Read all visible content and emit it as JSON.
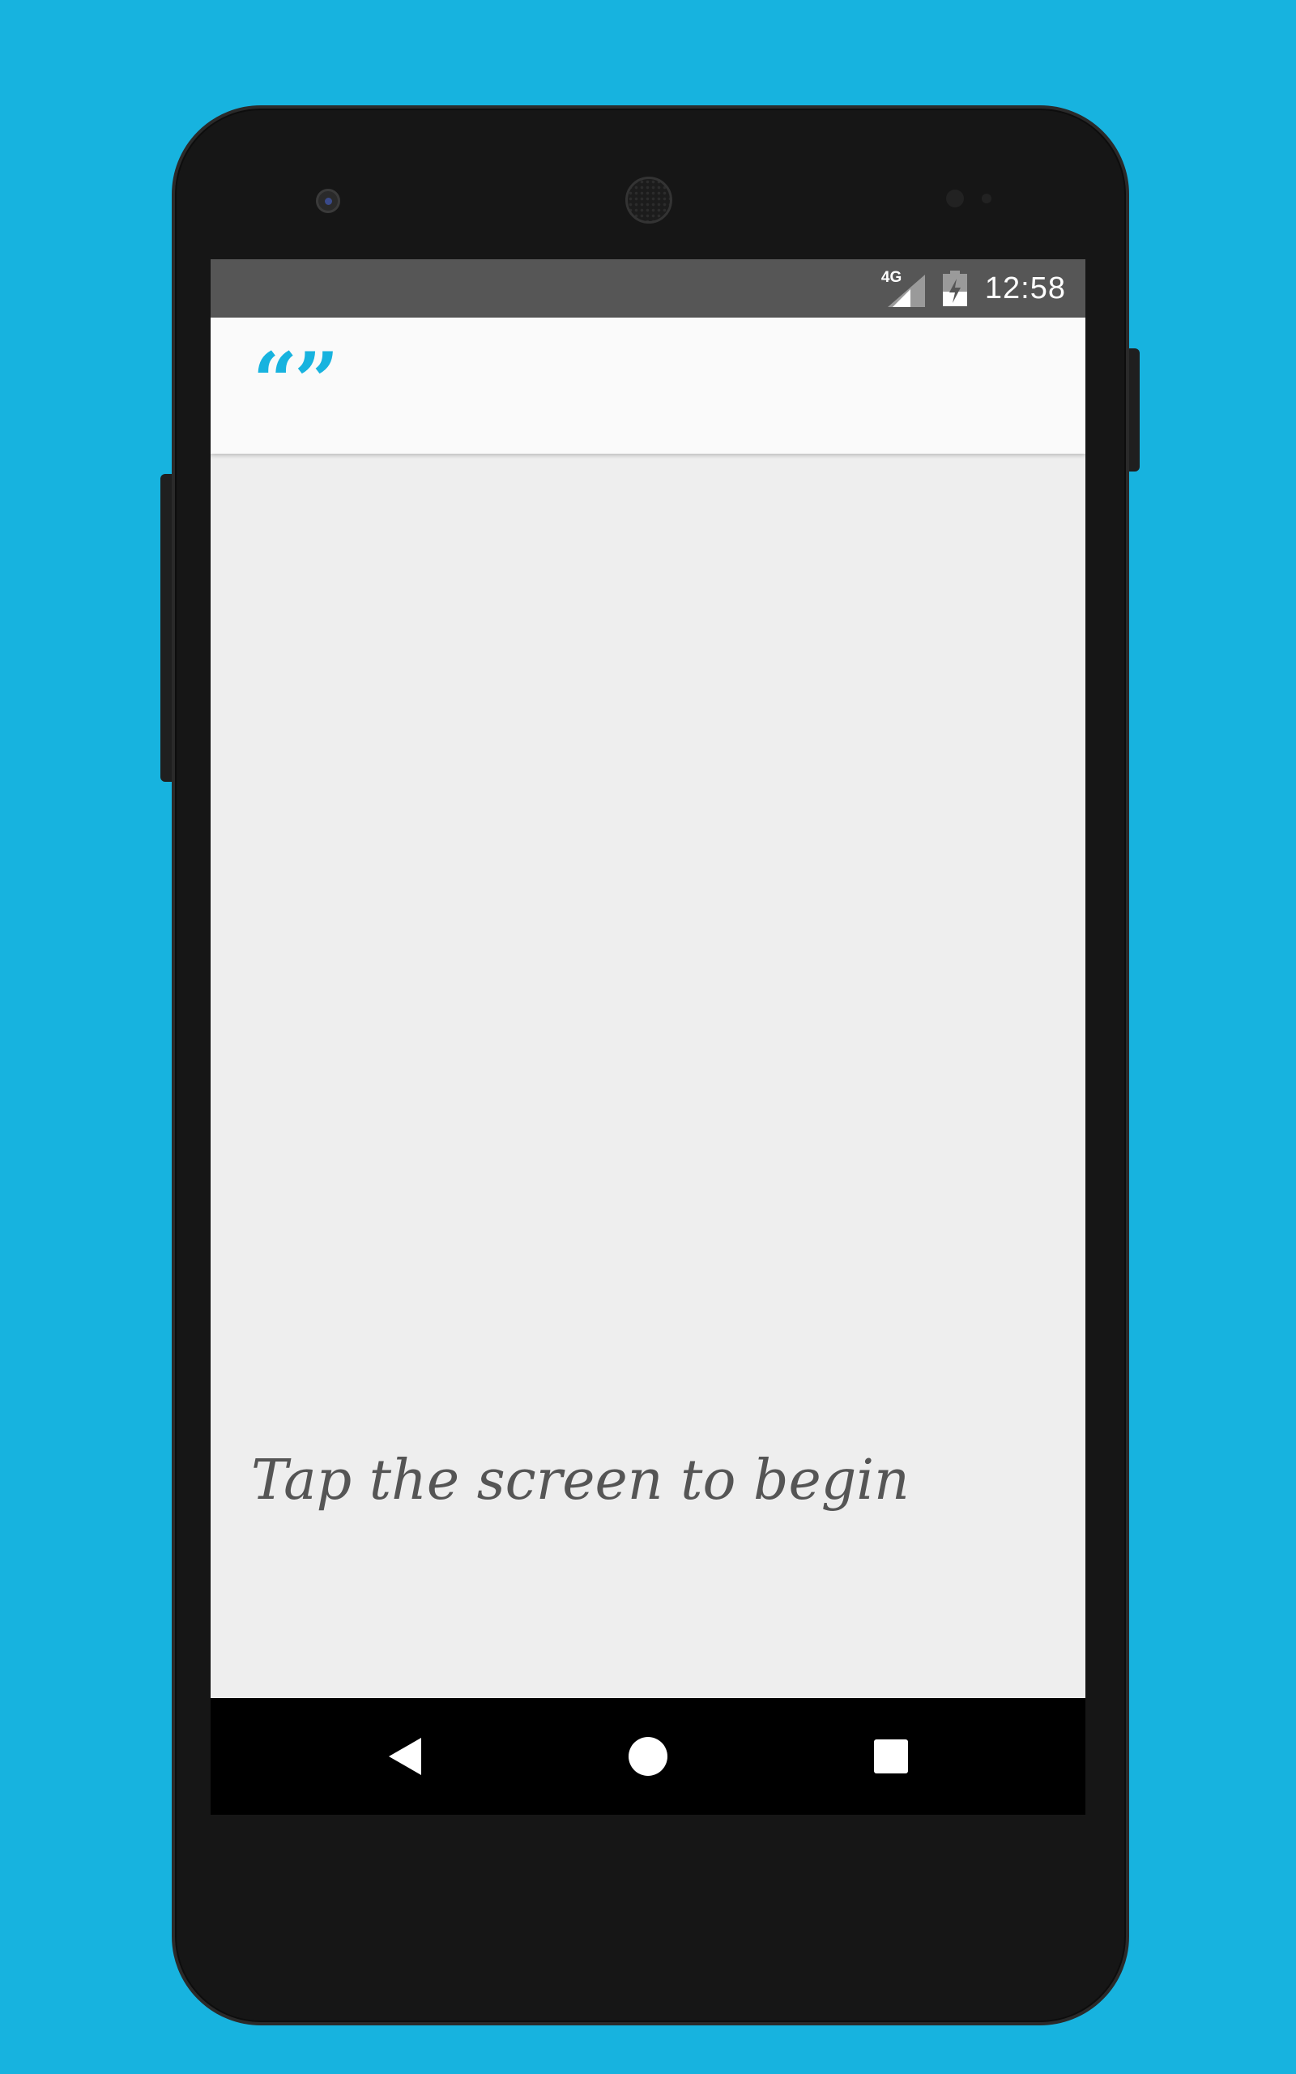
{
  "colors": {
    "background": "#17b3df",
    "accent": "#17b3df",
    "status_bar": "#565656",
    "app_bar": "#fafafa",
    "content_bg": "#eeeeee",
    "prompt_text": "#555555",
    "nav_bar": "#000000"
  },
  "status_bar": {
    "network_type": "4G",
    "time": "12:58",
    "icons": [
      "signal-icon",
      "battery-charging-icon"
    ]
  },
  "app_bar": {
    "logo": "“”"
  },
  "main": {
    "prompt": "Tap the screen to begin"
  },
  "nav_bar": {
    "icons": [
      "back-icon",
      "home-icon",
      "recents-icon"
    ]
  }
}
